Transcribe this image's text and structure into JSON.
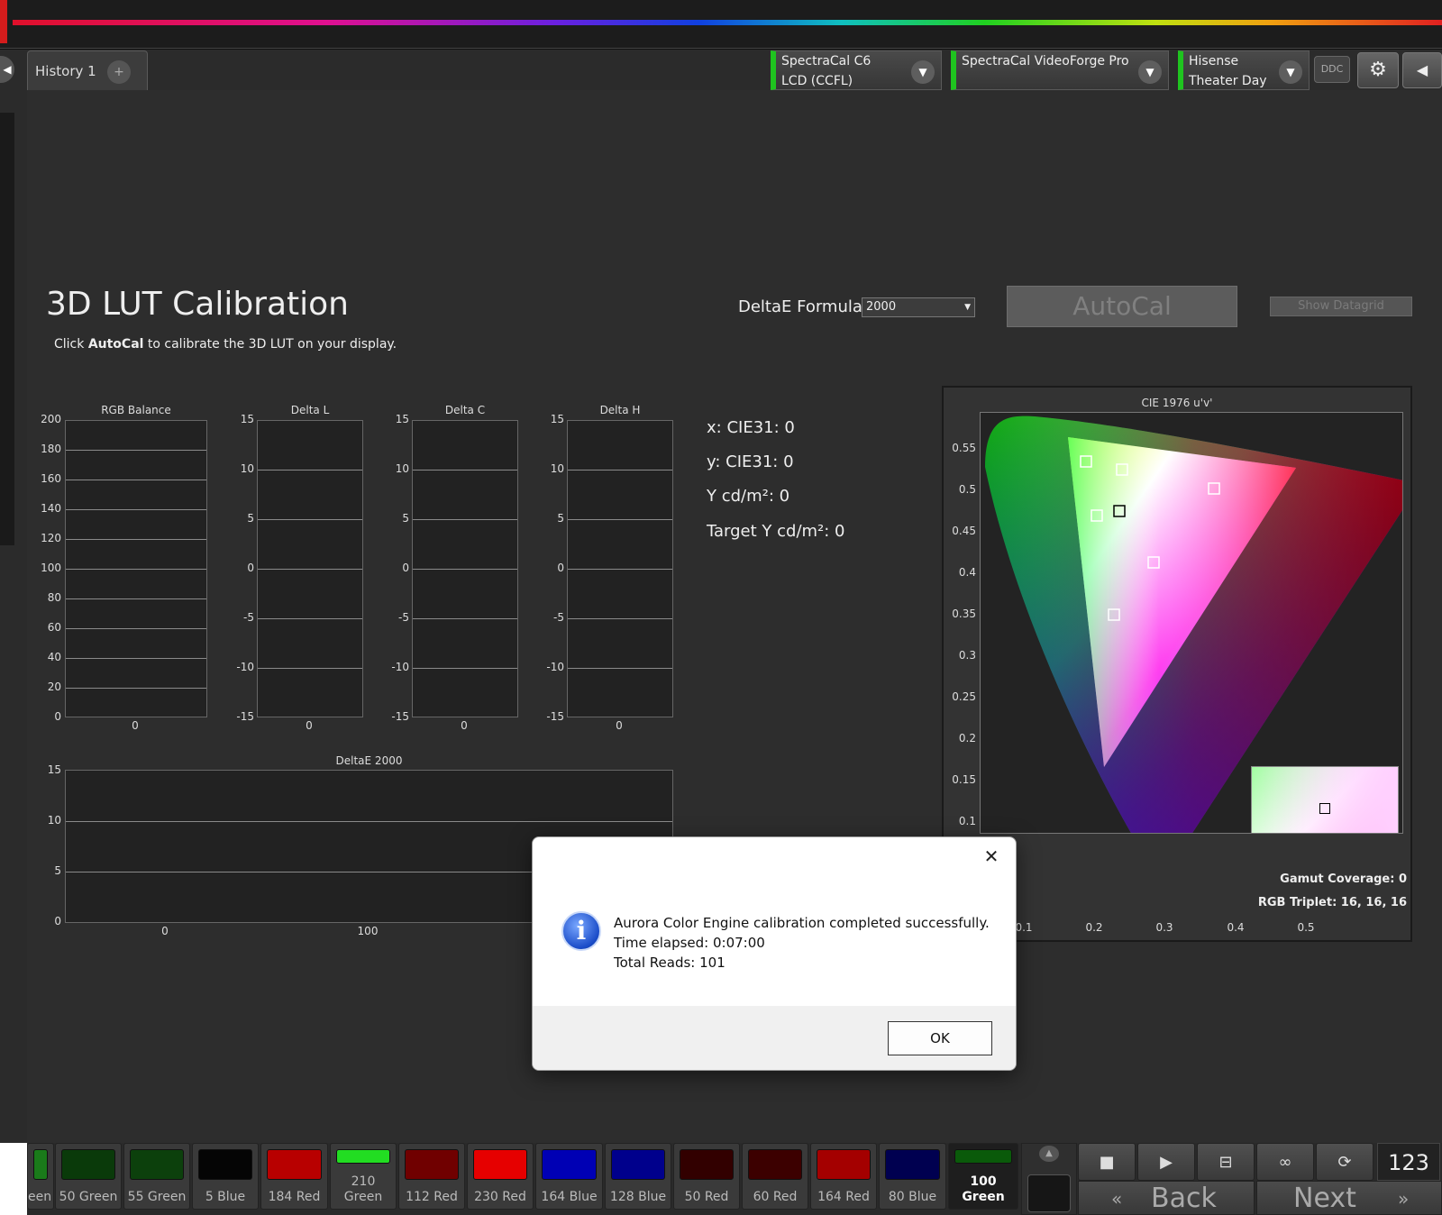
{
  "header": {
    "tabs": [
      {
        "label": "History 1"
      }
    ],
    "add_tab_label": "+",
    "devices": [
      {
        "line1": "SpectraCal C6",
        "line2": "LCD (CCFL)"
      },
      {
        "line1": "SpectraCal VideoForge Pro",
        "line2": ""
      },
      {
        "line1": "Hisense",
        "line2": "Theater Day"
      }
    ],
    "ddc_label": "DDC",
    "settings_icon": "gear-icon",
    "collapse_icon": "chevron-left-icon"
  },
  "page": {
    "title": "3D LUT Calibration",
    "subtitle_pre": "Click ",
    "subtitle_bold": "AutoCal",
    "subtitle_post": " to calibrate the 3D LUT on your display.",
    "deltae_label": "DeltaE Formula",
    "deltae_value": "2000",
    "autocal_label": "AutoCal",
    "show_datagrid_label": "Show Datagrid"
  },
  "charts": {
    "rgb_balance": {
      "title": "RGB Balance",
      "ticks": [
        "200",
        "180",
        "160",
        "140",
        "120",
        "100",
        "80",
        "60",
        "40",
        "20",
        "0"
      ],
      "x_label": "0"
    },
    "delta_l": {
      "title": "Delta L",
      "ticks": [
        "15",
        "10",
        "5",
        "0",
        "-5",
        "-10",
        "-15"
      ],
      "x_label": "0"
    },
    "delta_c": {
      "title": "Delta C",
      "ticks": [
        "15",
        "10",
        "5",
        "0",
        "-5",
        "-10",
        "-15"
      ],
      "x_label": "0"
    },
    "delta_h": {
      "title": "Delta H",
      "ticks": [
        "15",
        "10",
        "5",
        "0",
        "-5",
        "-10",
        "-15"
      ],
      "x_label": "0"
    },
    "deltae": {
      "title": "DeltaE 2000",
      "ticks": [
        "15",
        "10",
        "5",
        "0"
      ],
      "x_labels": [
        "0",
        "100"
      ]
    }
  },
  "readings": {
    "x": "x: CIE31: 0",
    "y": "y: CIE31: 0",
    "Y": "Y cd/m²: 0",
    "target": "Target Y cd/m²: 0"
  },
  "cie": {
    "title": "CIE 1976 u'v'",
    "y_ticks": [
      "0.55",
      "0.5",
      "0.45",
      "0.4",
      "0.35",
      "0.3",
      "0.25",
      "0.2",
      "0.15",
      "0.1"
    ],
    "x_ticks": [
      "0.1",
      "0.2",
      "0.3",
      "0.4",
      "0.5"
    ],
    "gamut_coverage": "Gamut Coverage: 0",
    "rgb_triplet": "RGB Triplet: 16, 16, 16"
  },
  "dialog": {
    "line1": "Aurora Color Engine calibration completed successfully.",
    "line2": "Time elapsed: 0:07:00",
    "line3": "Total Reads: 101",
    "ok_label": "OK",
    "info_icon": "info-icon",
    "close_icon": "close-icon"
  },
  "swatches": [
    {
      "label": "een",
      "color": "#1a7a1a"
    },
    {
      "label": "50 Green",
      "color": "#0a3a0a"
    },
    {
      "label": "55 Green",
      "color": "#0c400c"
    },
    {
      "label": "5 Blue",
      "color": "#050505"
    },
    {
      "label": "184 Red",
      "color": "#b80000"
    },
    {
      "label": "210 Green",
      "color": "#22dd22"
    },
    {
      "label": "112 Red",
      "color": "#700000"
    },
    {
      "label": "230 Red",
      "color": "#e60000"
    },
    {
      "label": "164 Blue",
      "color": "#0000b4"
    },
    {
      "label": "128 Blue",
      "color": "#00008c"
    },
    {
      "label": "50 Red",
      "color": "#320000"
    },
    {
      "label": "60 Red",
      "color": "#3c0000"
    },
    {
      "label": "164 Red",
      "color": "#a40000"
    },
    {
      "label": "80 Blue",
      "color": "#000050"
    },
    {
      "label": "100 Green",
      "color": "#0a5a0a"
    }
  ],
  "controls": {
    "counter": "123",
    "back_label": "Back",
    "next_label": "Next"
  }
}
